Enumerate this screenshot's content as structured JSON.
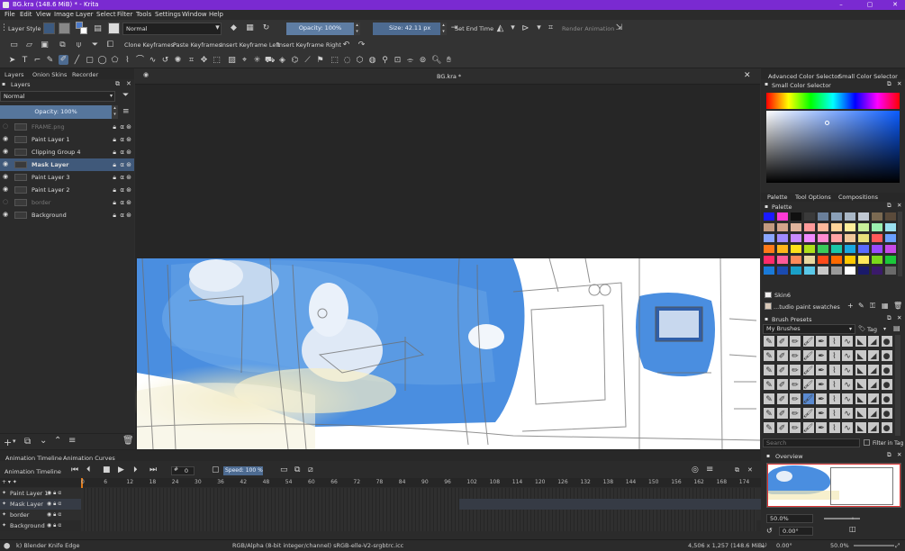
{
  "window": {
    "title": "BG.kra (148.6 MiB)  * - Krita",
    "minimize": "–",
    "maximize": "▢",
    "close": "✕",
    "accent": "#7a2ad1"
  },
  "menu": [
    "File",
    "Edit",
    "View",
    "Image",
    "Layer",
    "Select",
    "Filter",
    "Tools",
    "Settings",
    "Window",
    "Help"
  ],
  "toolbar": {
    "layer_style": "Layer Style",
    "blend_mode": "Normal",
    "opacity": "Opacity: 100%",
    "size": "Size: 42.11 px",
    "set_end_time": "Set End Time",
    "render_animation": "Render Animation"
  },
  "toolbar2": {
    "clone_keyframes": "Clone Keyframes",
    "paste_keyframes": "Paste Keyframes",
    "insert_keyframe_left": "Insert Keyframe Left",
    "insert_keyframe_right": "Insert Keyframe Right"
  },
  "left_tabs": [
    "Layers",
    "Onion Skins",
    "Recorder"
  ],
  "layers_panel": {
    "title": "Layers",
    "blend_mode": "Normal",
    "opacity": "Opacity:  100%",
    "layers": [
      {
        "name": "FRAME.png",
        "visible": false
      },
      {
        "name": "Paint Layer 1",
        "visible": true
      },
      {
        "name": "Clipping Group 4",
        "visible": true
      },
      {
        "name": "Mask Layer",
        "visible": true,
        "selected": true
      },
      {
        "name": "Paint Layer 3",
        "visible": true
      },
      {
        "name": "Paint Layer 2",
        "visible": true
      },
      {
        "name": "border",
        "visible": false
      },
      {
        "name": "Background",
        "visible": true
      }
    ]
  },
  "document_tab": "BG.kra *",
  "right_tabs_top": [
    "Advanced Color Selector",
    "Small Color Selector"
  ],
  "small_color_selector": {
    "title": "Small Color Selector"
  },
  "right_tabs_mid": [
    "Palette",
    "Tool Options",
    "Compositions"
  ],
  "palette": {
    "title": "Palette",
    "swatch_name": "Skin6",
    "palette_name": "...tudio paint swatches",
    "colors": [
      "#1a1aff",
      "#ff3ad6",
      "#101010",
      "#3a3a3a",
      "#6a7f9a",
      "#8aa0b8",
      "#a9b7c6",
      "#c0c8d2",
      "#7b6a52",
      "#5a4a3a",
      "#c29a80",
      "#d4a48a",
      "#e0b49c",
      "#ff9a9a",
      "#ffb89a",
      "#ffd59a",
      "#ffef9a",
      "#c8f09a",
      "#9af0b0",
      "#9ae0f0",
      "#8aa6ff",
      "#a08aff",
      "#c88aff",
      "#f08aff",
      "#ff8ad0",
      "#ffa4a4",
      "#f0c89a",
      "#e8e07a",
      "#ff5a5a",
      "#6aa0ff",
      "#ff7a1a",
      "#ffb51a",
      "#ffe01a",
      "#b0e01a",
      "#3acb5a",
      "#1ac8a8",
      "#1aa8e0",
      "#5a6aff",
      "#9a4aff",
      "#c84ae8",
      "#ff2a6a",
      "#ff5a9a",
      "#ff8a5a",
      "#e8d8a0",
      "#ff4a1a",
      "#ff6a00",
      "#ffc800",
      "#ffe85a",
      "#7ad81a",
      "#1ac83a",
      "#1a7ad8",
      "#1a4ab0",
      "#1aa0c8",
      "#5ac8e8",
      "#c8c8c8",
      "#9a9a9a",
      "#ffffff",
      "#1a1a6a",
      "#3a1a6a",
      "#6a6a6a"
    ]
  },
  "brush_presets": {
    "title": "Brush Presets",
    "tag_label": "My Brushes",
    "tag_button": "Tag",
    "search_placeholder": "Search",
    "filter_in_tag": "Filter in Tag"
  },
  "overview": {
    "title": "Overview",
    "zoom": "50.0%",
    "rotation": "0.00°"
  },
  "timeline": {
    "tabs": [
      "Animation Timeline",
      "Animation Curves"
    ],
    "title": "Animation Timeline",
    "current_frame": "0",
    "speed": "Speed: 100 %",
    "frames": [
      "0",
      "6",
      "12",
      "18",
      "24",
      "30",
      "36",
      "42",
      "48",
      "54",
      "60",
      "66",
      "72",
      "78",
      "84",
      "90",
      "96",
      "102",
      "108",
      "114",
      "120",
      "126",
      "132",
      "138",
      "144",
      "150",
      "156",
      "162",
      "168",
      "174"
    ],
    "layers": [
      "Paint Layer 1",
      "Mask Layer",
      "border",
      "Background"
    ]
  },
  "status": {
    "tool": "k) Blender Knife Edge",
    "color_info": "RGB/Alpha (8-bit integer/channel)  sRGB-elle-V2-srgbtrc.icc",
    "dims": "4,506 x 1,257 (148.6 MiB)",
    "rotation": "0.00°",
    "zoom": "50.0%"
  }
}
